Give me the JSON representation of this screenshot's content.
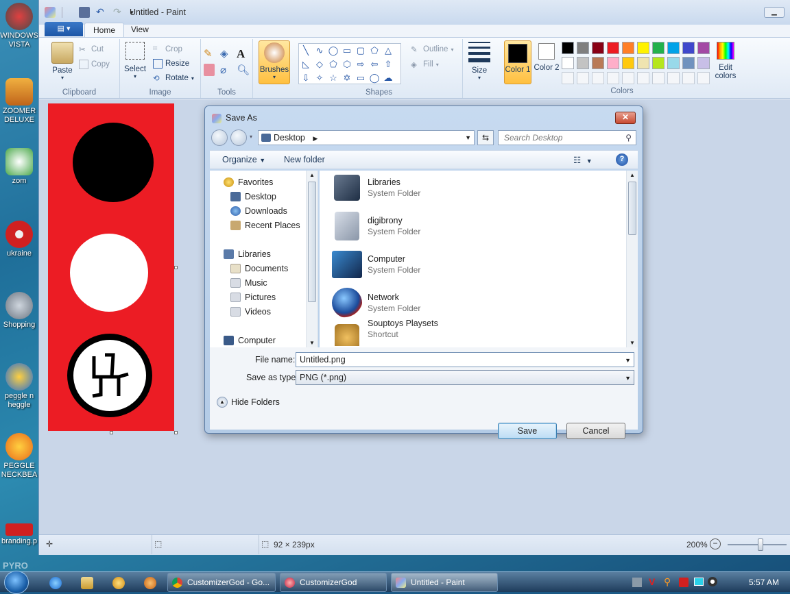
{
  "desktop": {
    "icons": [
      {
        "label": "WINDOWS VISTA",
        "color": "#5a5a5a"
      },
      {
        "label": "ZOOMER DELUXE",
        "color": "#e08a1a"
      },
      {
        "label": "zom",
        "color": "#4aa84a"
      },
      {
        "label": "ukraine",
        "color": "#d02020"
      },
      {
        "label": "Shopping",
        "color": "#8a8a8a"
      },
      {
        "label": "peggle n heggle",
        "color": "#2a6ed0"
      },
      {
        "label": "PEGGLE NECKBEA",
        "color": "#e86a1a"
      },
      {
        "label": "branding.p",
        "color": "#d02020"
      }
    ],
    "watermark": "PYRO"
  },
  "paint": {
    "title": "Untitled - Paint",
    "file_tab": "▤ ▾",
    "tabs": [
      {
        "label": "Home"
      },
      {
        "label": "View"
      }
    ],
    "clipboard": {
      "paste": "Paste",
      "cut": "Cut",
      "copy": "Copy",
      "label": "Clipboard"
    },
    "image": {
      "select": "Select",
      "crop": "Crop",
      "resize": "Resize",
      "rotate": "Rotate",
      "label": "Image"
    },
    "tools": {
      "label": "Tools"
    },
    "brushes": "Brushes",
    "shapes": {
      "outline": "Outline",
      "fill": "Fill",
      "label": "Shapes"
    },
    "size": "Size",
    "color1": "Color 1",
    "color2": "Color 2",
    "colors_label": "Colors",
    "edit_colors": "Edit colors",
    "palette_row1": [
      "#000000",
      "#7f7f7f",
      "#880015",
      "#ed1c24",
      "#ff7f27",
      "#fff200",
      "#22b14c",
      "#00a2e8",
      "#3f48cc",
      "#a349a4"
    ],
    "palette_row2": [
      "#ffffff",
      "#c3c3c3",
      "#b97a57",
      "#ffaec9",
      "#ffc90e",
      "#efe4b0",
      "#b5e61d",
      "#99d9ea",
      "#7092be",
      "#c8bfe7"
    ],
    "status": {
      "dimensions": "92 × 239px",
      "zoom": "200%"
    }
  },
  "dialog": {
    "title": "Save As",
    "address": "Desktop",
    "search_placeholder": "Search Desktop",
    "organize": "Organize",
    "new_folder": "New folder",
    "nav": {
      "favorites": "Favorites",
      "desktop": "Desktop",
      "downloads": "Downloads",
      "recent": "Recent Places",
      "libraries": "Libraries",
      "documents": "Documents",
      "music": "Music",
      "pictures": "Pictures",
      "videos": "Videos",
      "computer": "Computer"
    },
    "files": [
      {
        "name": "Libraries",
        "type": "System Folder"
      },
      {
        "name": "digibrony",
        "type": "System Folder"
      },
      {
        "name": "Computer",
        "type": "System Folder"
      },
      {
        "name": "Network",
        "type": "System Folder"
      },
      {
        "name": "Souptoys Playsets",
        "type": "Shortcut"
      }
    ],
    "file_name_label": "File name:",
    "file_name": "Untitled.png",
    "type_label": "Save as type:",
    "type_value": "PNG (*.png)",
    "hide_folders": "Hide Folders",
    "save": "Save",
    "cancel": "Cancel"
  },
  "taskbar": {
    "tasks": [
      {
        "label": "CustomizerGod - Go..."
      },
      {
        "label": "CustomizerGod"
      },
      {
        "label": "Untitled - Paint"
      }
    ],
    "clock": "5:57 AM"
  }
}
